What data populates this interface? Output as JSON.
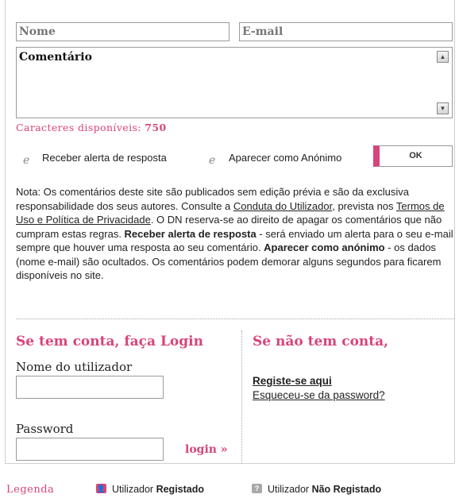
{
  "form": {
    "name_placeholder": "Nome",
    "email_placeholder": "E-mail",
    "comment_placeholder": "Comentário",
    "chars_label": "Caracteres disponíveis:",
    "chars_count": "750",
    "opt_alert": "Receber alerta de resposta",
    "opt_anon": "Aparecer como Anónimo",
    "ok_label": "OK"
  },
  "note": {
    "p1": "Nota: Os comentários deste site são publicados sem edição prévia e são da exclusiva responsabilidade dos seus autores. Consulte a ",
    "link1": "Conduta do Utilizador",
    "p2": ", prevista nos ",
    "link2": "Termos de Uso e Política de Privacidade",
    "p3": ". O DN reserva-se ao direito de apagar os comentários que não cumpram estas regras. ",
    "b1": "Receber alerta de resposta",
    "p4": " - será enviado um alerta para o seu e-mail sempre que houver uma resposta ao seu comentário. ",
    "b2": "Aparecer como anónimo",
    "p5": " - os dados (nome e-mail) são ocultados. Os comentários podem demorar alguns segundos para ficarem disponíveis no site."
  },
  "login": {
    "heading": "Se tem conta, faça Login",
    "user_label": "Nome do utilizador",
    "password_label": "Password",
    "submit": "login »"
  },
  "register": {
    "heading": "Se não tem conta,",
    "register_link": "Registe-se aqui",
    "forgot_link": "Esqueceu-se da password?"
  },
  "legend": {
    "title": "Legenda",
    "registered_prefix": "Utilizador ",
    "registered_bold": "Registado",
    "unregistered_prefix": "Utilizador ",
    "unregistered_bold": "Não Registado",
    "registered_color": "#d9447a",
    "unregistered_color": "#a9a9a9"
  }
}
